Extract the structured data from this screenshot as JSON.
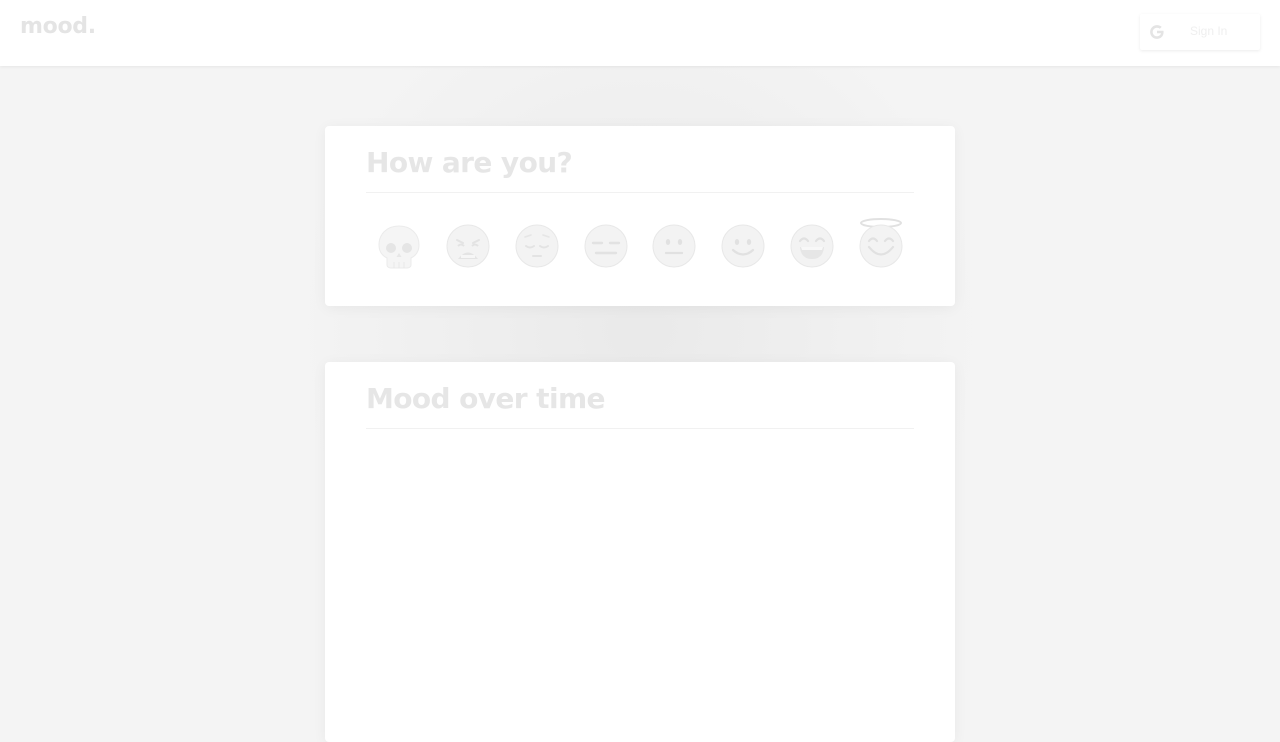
{
  "app": {
    "logo": "mood.",
    "signin_label": "Sign In"
  },
  "mood_card": {
    "title": "How are you?",
    "options": [
      {
        "name": "skull",
        "icon": "skull-icon"
      },
      {
        "name": "weary",
        "icon": "weary-face-icon"
      },
      {
        "name": "pensive",
        "icon": "pensive-face-icon"
      },
      {
        "name": "expressionless",
        "icon": "expressionless-face-icon"
      },
      {
        "name": "neutral",
        "icon": "neutral-face-icon"
      },
      {
        "name": "slightly-smiling",
        "icon": "slightly-smiling-face-icon"
      },
      {
        "name": "grinning",
        "icon": "grinning-face-icon"
      },
      {
        "name": "angel",
        "icon": "smiling-face-with-halo-icon"
      }
    ]
  },
  "chart_card": {
    "title": "Mood over time"
  },
  "colors": {
    "background": "#f4f4f4",
    "card": "#ffffff",
    "faded_text": "#e6e6e6"
  }
}
